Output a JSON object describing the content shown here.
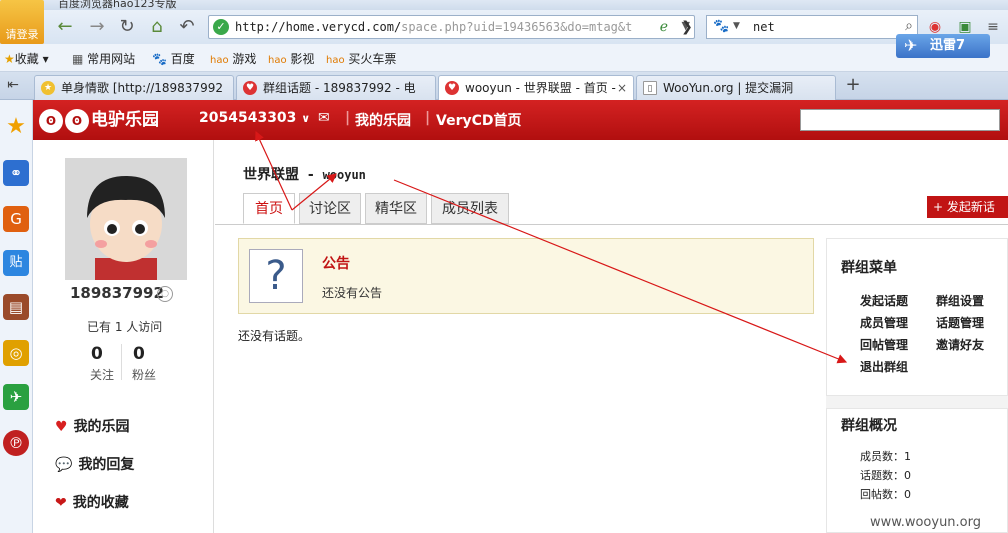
{
  "browser": {
    "title": "百度浏览器hao123专版",
    "login": "请登录",
    "url_main": "http://home.verycd.com/",
    "url_rest": "space.php?uid=19436563&do=mtag&t",
    "search_text": "net",
    "xunlei": "迅雷7"
  },
  "bookmarks": [
    "收藏",
    "常用网站",
    "百度",
    "游戏",
    "影视",
    "买火车票"
  ],
  "tabs": [
    {
      "label": "单身情歌 [http://189837992"
    },
    {
      "label": "群组话题 - 189837992 - 电"
    },
    {
      "label": "wooyun - 世界联盟 - 首页 -"
    },
    {
      "label": "WooYun.org | 提交漏洞"
    }
  ],
  "site": {
    "logo": "电驴乐园",
    "user_id": "2054543303",
    "my_park": "我的乐园",
    "home": "VeryCD首页"
  },
  "profile": {
    "name": "189837992",
    "visits": "已有 1 人访问",
    "follow_count": "0",
    "follow_label": "关注",
    "fans_count": "0",
    "fans_label": "粉丝",
    "menu": [
      "我的乐园",
      "我的回复",
      "我的收藏"
    ]
  },
  "group": {
    "name": "世界联盟",
    "sep": "-",
    "subname": "wooyun",
    "tabs": [
      "首页",
      "讨论区",
      "精华区",
      "成员列表"
    ],
    "new_topic": "+ 发起新话",
    "notice_title": "公告",
    "notice_text": "还没有公告",
    "no_topics": "还没有话题。"
  },
  "menu": {
    "title": "群组菜单",
    "items": [
      "发起话题",
      "群组设置",
      "成员管理",
      "话题管理",
      "回帖管理",
      "邀请好友",
      "退出群组"
    ]
  },
  "overview": {
    "title": "群组概况",
    "members": "成员数：1",
    "topics": "话题数：0",
    "replies": "回帖数：0"
  },
  "watermark": "www.wooyun.org",
  "colors": {
    "brand_red": "#c11414",
    "annotation_red": "#d81818"
  }
}
